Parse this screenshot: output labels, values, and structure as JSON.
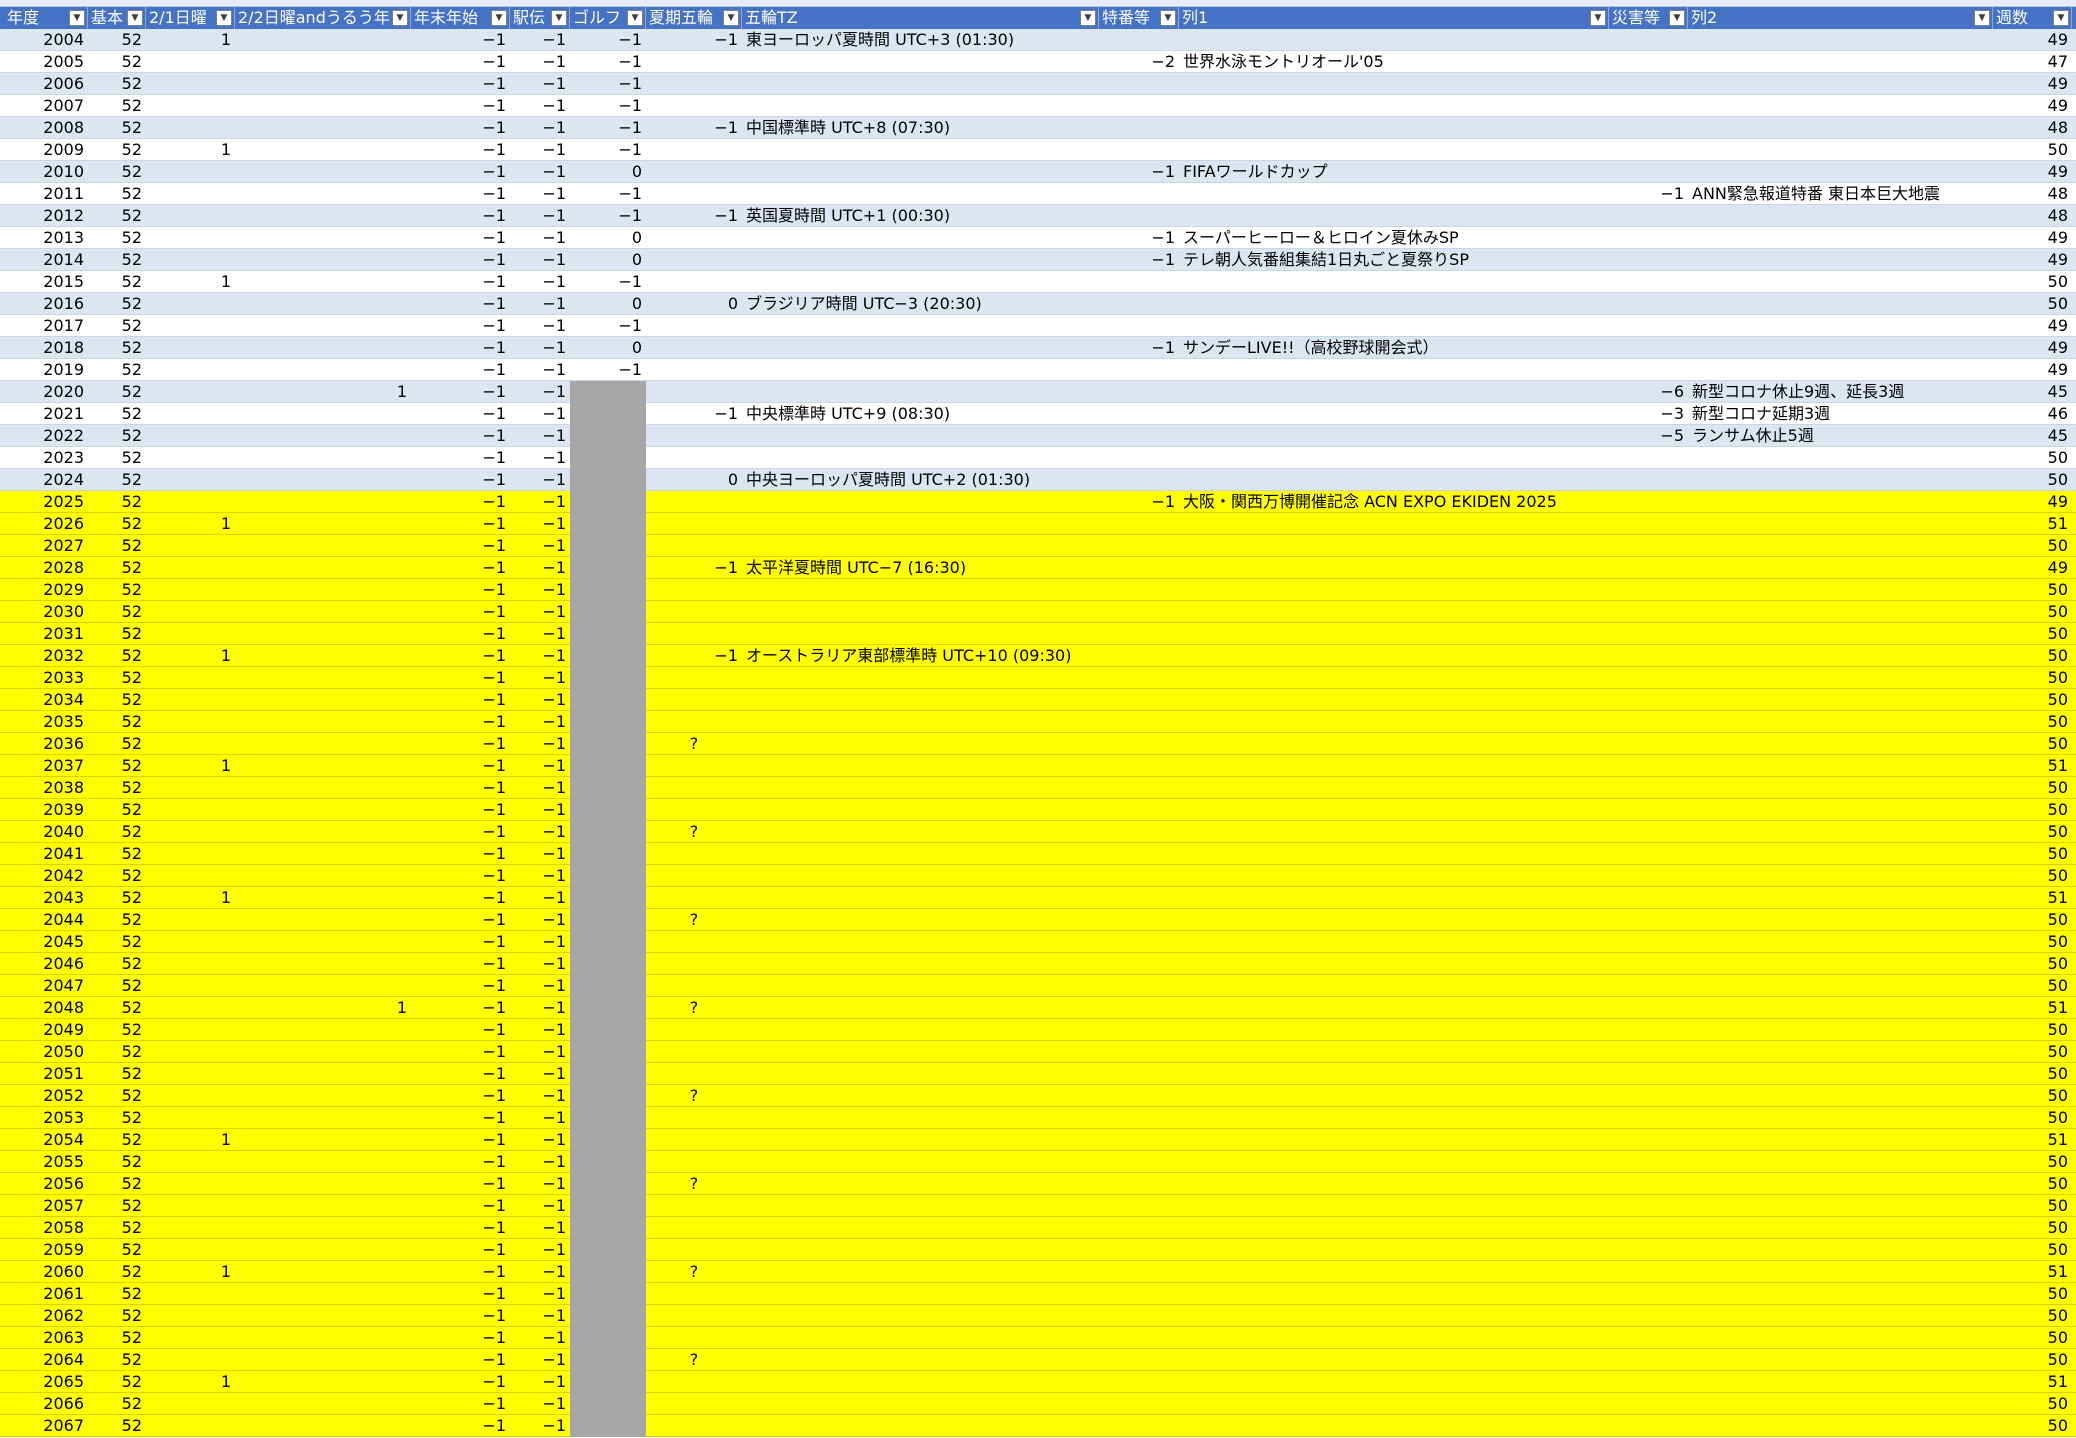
{
  "header": {
    "columns": [
      {
        "key": "year",
        "label": "年度"
      },
      {
        "key": "base",
        "label": "基本"
      },
      {
        "key": "sun21",
        "label": "2/1日曜"
      },
      {
        "key": "sun22",
        "label": "2/2日曜andうるう年"
      },
      {
        "key": "nye",
        "label": "年末年始"
      },
      {
        "key": "ekiden",
        "label": "駅伝"
      },
      {
        "key": "golf",
        "label": "ゴルフ"
      },
      {
        "key": "summer",
        "label": "夏期五輪"
      },
      {
        "key": "tz",
        "label": "五輪TZ"
      },
      {
        "key": "special",
        "label": "特番等"
      },
      {
        "key": "col1",
        "label": "列1"
      },
      {
        "key": "disaster",
        "label": "災害等"
      },
      {
        "key": "col2",
        "label": "列2"
      },
      {
        "key": "weeks",
        "label": "週数"
      }
    ],
    "filter_icon": "dropdown-arrow-icon",
    "filter_glyph": "▼"
  },
  "colors": {
    "header_bg": "#4472C4",
    "band_bg": "#DCE6F1",
    "forecast_bg": "#FFFF00",
    "golf_blank_bg": "#A6A6A6"
  },
  "rows": [
    {
      "year": "2004",
      "base": "52",
      "sun21": "1",
      "sun22": "",
      "nye": "−1",
      "ekiden": "−1",
      "golf": "−1",
      "summer": "−1",
      "tz": "東ヨーロッパ夏時間 UTC+3 (01:30)",
      "special": "",
      "col1": "",
      "disaster": "",
      "col2": "",
      "weeks": "49"
    },
    {
      "year": "2005",
      "base": "52",
      "sun21": "",
      "sun22": "",
      "nye": "−1",
      "ekiden": "−1",
      "golf": "−1",
      "summer": "",
      "tz": "",
      "special": "−2",
      "col1": "世界水泳モントリオール'05",
      "disaster": "",
      "col2": "",
      "weeks": "47"
    },
    {
      "year": "2006",
      "base": "52",
      "sun21": "",
      "sun22": "",
      "nye": "−1",
      "ekiden": "−1",
      "golf": "−1",
      "summer": "",
      "tz": "",
      "special": "",
      "col1": "",
      "disaster": "",
      "col2": "",
      "weeks": "49"
    },
    {
      "year": "2007",
      "base": "52",
      "sun21": "",
      "sun22": "",
      "nye": "−1",
      "ekiden": "−1",
      "golf": "−1",
      "summer": "",
      "tz": "",
      "special": "",
      "col1": "",
      "disaster": "",
      "col2": "",
      "weeks": "49"
    },
    {
      "year": "2008",
      "base": "52",
      "sun21": "",
      "sun22": "",
      "nye": "−1",
      "ekiden": "−1",
      "golf": "−1",
      "summer": "−1",
      "tz": "中国標準時 UTC+8 (07:30)",
      "special": "",
      "col1": "",
      "disaster": "",
      "col2": "",
      "weeks": "48"
    },
    {
      "year": "2009",
      "base": "52",
      "sun21": "1",
      "sun22": "",
      "nye": "−1",
      "ekiden": "−1",
      "golf": "−1",
      "summer": "",
      "tz": "",
      "special": "",
      "col1": "",
      "disaster": "",
      "col2": "",
      "weeks": "50"
    },
    {
      "year": "2010",
      "base": "52",
      "sun21": "",
      "sun22": "",
      "nye": "−1",
      "ekiden": "−1",
      "golf": "0",
      "summer": "",
      "tz": "",
      "special": "−1",
      "col1": "FIFAワールドカップ",
      "disaster": "",
      "col2": "",
      "weeks": "49"
    },
    {
      "year": "2011",
      "base": "52",
      "sun21": "",
      "sun22": "",
      "nye": "−1",
      "ekiden": "−1",
      "golf": "−1",
      "summer": "",
      "tz": "",
      "special": "",
      "col1": "",
      "disaster": "−1",
      "col2": "ANN緊急報道特番 東日本巨大地震",
      "weeks": "48"
    },
    {
      "year": "2012",
      "base": "52",
      "sun21": "",
      "sun22": "",
      "nye": "−1",
      "ekiden": "−1",
      "golf": "−1",
      "summer": "−1",
      "tz": "英国夏時間 UTC+1 (00:30)",
      "special": "",
      "col1": "",
      "disaster": "",
      "col2": "",
      "weeks": "48"
    },
    {
      "year": "2013",
      "base": "52",
      "sun21": "",
      "sun22": "",
      "nye": "−1",
      "ekiden": "−1",
      "golf": "0",
      "summer": "",
      "tz": "",
      "special": "−1",
      "col1": "スーパーヒーロー＆ヒロイン夏休みSP",
      "disaster": "",
      "col2": "",
      "weeks": "49"
    },
    {
      "year": "2014",
      "base": "52",
      "sun21": "",
      "sun22": "",
      "nye": "−1",
      "ekiden": "−1",
      "golf": "0",
      "summer": "",
      "tz": "",
      "special": "−1",
      "col1": "テレ朝人気番組集結1日丸ごと夏祭りSP",
      "disaster": "",
      "col2": "",
      "weeks": "49"
    },
    {
      "year": "2015",
      "base": "52",
      "sun21": "1",
      "sun22": "",
      "nye": "−1",
      "ekiden": "−1",
      "golf": "−1",
      "summer": "",
      "tz": "",
      "special": "",
      "col1": "",
      "disaster": "",
      "col2": "",
      "weeks": "50"
    },
    {
      "year": "2016",
      "base": "52",
      "sun21": "",
      "sun22": "",
      "nye": "−1",
      "ekiden": "−1",
      "golf": "0",
      "summer": "0",
      "tz": "ブラジリア時間 UTC−3 (20:30)",
      "special": "",
      "col1": "",
      "disaster": "",
      "col2": "",
      "weeks": "50"
    },
    {
      "year": "2017",
      "base": "52",
      "sun21": "",
      "sun22": "",
      "nye": "−1",
      "ekiden": "−1",
      "golf": "−1",
      "summer": "",
      "tz": "",
      "special": "",
      "col1": "",
      "disaster": "",
      "col2": "",
      "weeks": "49"
    },
    {
      "year": "2018",
      "base": "52",
      "sun21": "",
      "sun22": "",
      "nye": "−1",
      "ekiden": "−1",
      "golf": "0",
      "summer": "",
      "tz": "",
      "special": "−1",
      "col1": "サンデーLIVE!!（高校野球開会式）",
      "disaster": "",
      "col2": "",
      "weeks": "49"
    },
    {
      "year": "2019",
      "base": "52",
      "sun21": "",
      "sun22": "",
      "nye": "−1",
      "ekiden": "−1",
      "golf": "−1",
      "summer": "",
      "tz": "",
      "special": "",
      "col1": "",
      "disaster": "",
      "col2": "",
      "weeks": "49"
    },
    {
      "year": "2020",
      "base": "52",
      "sun21": "",
      "sun22": "1",
      "nye": "−1",
      "ekiden": "−1",
      "golf": "",
      "summer": "",
      "tz": "",
      "special": "",
      "col1": "",
      "disaster": "−6",
      "col2": "新型コロナ休止9週、延長3週",
      "weeks": "45"
    },
    {
      "year": "2021",
      "base": "52",
      "sun21": "",
      "sun22": "",
      "nye": "−1",
      "ekiden": "−1",
      "golf": "",
      "summer": "−1",
      "tz": "中央標準時 UTC+9 (08:30)",
      "special": "",
      "col1": "",
      "disaster": "−3",
      "col2": "新型コロナ延期3週",
      "weeks": "46"
    },
    {
      "year": "2022",
      "base": "52",
      "sun21": "",
      "sun22": "",
      "nye": "−1",
      "ekiden": "−1",
      "golf": "",
      "summer": "",
      "tz": "",
      "special": "",
      "col1": "",
      "disaster": "−5",
      "col2": "ランサム休止5週",
      "weeks": "45"
    },
    {
      "year": "2023",
      "base": "52",
      "sun21": "",
      "sun22": "",
      "nye": "−1",
      "ekiden": "−1",
      "golf": "",
      "summer": "",
      "tz": "",
      "special": "",
      "col1": "",
      "disaster": "",
      "col2": "",
      "weeks": "50"
    },
    {
      "year": "2024",
      "base": "52",
      "sun21": "",
      "sun22": "",
      "nye": "−1",
      "ekiden": "−1",
      "golf": "",
      "summer": "0",
      "tz": "中央ヨーロッパ夏時間 UTC+2 (01:30)",
      "special": "",
      "col1": "",
      "disaster": "",
      "col2": "",
      "weeks": "50"
    },
    {
      "year": "2025",
      "base": "52",
      "sun21": "",
      "sun22": "",
      "nye": "−1",
      "ekiden": "−1",
      "golf": "",
      "summer": "",
      "tz": "",
      "special": "−1",
      "col1": "大阪・関西万博開催記念 ACN EXPO EKIDEN 2025",
      "disaster": "",
      "col2": "",
      "weeks": "49"
    },
    {
      "year": "2026",
      "base": "52",
      "sun21": "1",
      "sun22": "",
      "nye": "−1",
      "ekiden": "−1",
      "golf": "",
      "summer": "",
      "tz": "",
      "special": "",
      "col1": "",
      "disaster": "",
      "col2": "",
      "weeks": "51"
    },
    {
      "year": "2027",
      "base": "52",
      "sun21": "",
      "sun22": "",
      "nye": "−1",
      "ekiden": "−1",
      "golf": "",
      "summer": "",
      "tz": "",
      "special": "",
      "col1": "",
      "disaster": "",
      "col2": "",
      "weeks": "50"
    },
    {
      "year": "2028",
      "base": "52",
      "sun21": "",
      "sun22": "",
      "nye": "−1",
      "ekiden": "−1",
      "golf": "",
      "summer": "−1",
      "tz": "太平洋夏時間 UTC−7 (16:30)",
      "special": "",
      "col1": "",
      "disaster": "",
      "col2": "",
      "weeks": "49"
    },
    {
      "year": "2029",
      "base": "52",
      "sun21": "",
      "sun22": "",
      "nye": "−1",
      "ekiden": "−1",
      "golf": "",
      "summer": "",
      "tz": "",
      "special": "",
      "col1": "",
      "disaster": "",
      "col2": "",
      "weeks": "50"
    },
    {
      "year": "2030",
      "base": "52",
      "sun21": "",
      "sun22": "",
      "nye": "−1",
      "ekiden": "−1",
      "golf": "",
      "summer": "",
      "tz": "",
      "special": "",
      "col1": "",
      "disaster": "",
      "col2": "",
      "weeks": "50"
    },
    {
      "year": "2031",
      "base": "52",
      "sun21": "",
      "sun22": "",
      "nye": "−1",
      "ekiden": "−1",
      "golf": "",
      "summer": "",
      "tz": "",
      "special": "",
      "col1": "",
      "disaster": "",
      "col2": "",
      "weeks": "50"
    },
    {
      "year": "2032",
      "base": "52",
      "sun21": "1",
      "sun22": "",
      "nye": "−1",
      "ekiden": "−1",
      "golf": "",
      "summer": "−1",
      "tz": "オーストラリア東部標準時 UTC+10 (09:30)",
      "special": "",
      "col1": "",
      "disaster": "",
      "col2": "",
      "weeks": "50"
    },
    {
      "year": "2033",
      "base": "52",
      "sun21": "",
      "sun22": "",
      "nye": "−1",
      "ekiden": "−1",
      "golf": "",
      "summer": "",
      "tz": "",
      "special": "",
      "col1": "",
      "disaster": "",
      "col2": "",
      "weeks": "50"
    },
    {
      "year": "2034",
      "base": "52",
      "sun21": "",
      "sun22": "",
      "nye": "−1",
      "ekiden": "−1",
      "golf": "",
      "summer": "",
      "tz": "",
      "special": "",
      "col1": "",
      "disaster": "",
      "col2": "",
      "weeks": "50"
    },
    {
      "year": "2035",
      "base": "52",
      "sun21": "",
      "sun22": "",
      "nye": "−1",
      "ekiden": "−1",
      "golf": "",
      "summer": "",
      "tz": "",
      "special": "",
      "col1": "",
      "disaster": "",
      "col2": "",
      "weeks": "50"
    },
    {
      "year": "2036",
      "base": "52",
      "sun21": "",
      "sun22": "",
      "nye": "−1",
      "ekiden": "−1",
      "golf": "",
      "summer": "?",
      "tz": "",
      "special": "",
      "col1": "",
      "disaster": "",
      "col2": "",
      "weeks": "50"
    },
    {
      "year": "2037",
      "base": "52",
      "sun21": "1",
      "sun22": "",
      "nye": "−1",
      "ekiden": "−1",
      "golf": "",
      "summer": "",
      "tz": "",
      "special": "",
      "col1": "",
      "disaster": "",
      "col2": "",
      "weeks": "51"
    },
    {
      "year": "2038",
      "base": "52",
      "sun21": "",
      "sun22": "",
      "nye": "−1",
      "ekiden": "−1",
      "golf": "",
      "summer": "",
      "tz": "",
      "special": "",
      "col1": "",
      "disaster": "",
      "col2": "",
      "weeks": "50"
    },
    {
      "year": "2039",
      "base": "52",
      "sun21": "",
      "sun22": "",
      "nye": "−1",
      "ekiden": "−1",
      "golf": "",
      "summer": "",
      "tz": "",
      "special": "",
      "col1": "",
      "disaster": "",
      "col2": "",
      "weeks": "50"
    },
    {
      "year": "2040",
      "base": "52",
      "sun21": "",
      "sun22": "",
      "nye": "−1",
      "ekiden": "−1",
      "golf": "",
      "summer": "?",
      "tz": "",
      "special": "",
      "col1": "",
      "disaster": "",
      "col2": "",
      "weeks": "50"
    },
    {
      "year": "2041",
      "base": "52",
      "sun21": "",
      "sun22": "",
      "nye": "−1",
      "ekiden": "−1",
      "golf": "",
      "summer": "",
      "tz": "",
      "special": "",
      "col1": "",
      "disaster": "",
      "col2": "",
      "weeks": "50"
    },
    {
      "year": "2042",
      "base": "52",
      "sun21": "",
      "sun22": "",
      "nye": "−1",
      "ekiden": "−1",
      "golf": "",
      "summer": "",
      "tz": "",
      "special": "",
      "col1": "",
      "disaster": "",
      "col2": "",
      "weeks": "50"
    },
    {
      "year": "2043",
      "base": "52",
      "sun21": "1",
      "sun22": "",
      "nye": "−1",
      "ekiden": "−1",
      "golf": "",
      "summer": "",
      "tz": "",
      "special": "",
      "col1": "",
      "disaster": "",
      "col2": "",
      "weeks": "51"
    },
    {
      "year": "2044",
      "base": "52",
      "sun21": "",
      "sun22": "",
      "nye": "−1",
      "ekiden": "−1",
      "golf": "",
      "summer": "?",
      "tz": "",
      "special": "",
      "col1": "",
      "disaster": "",
      "col2": "",
      "weeks": "50"
    },
    {
      "year": "2045",
      "base": "52",
      "sun21": "",
      "sun22": "",
      "nye": "−1",
      "ekiden": "−1",
      "golf": "",
      "summer": "",
      "tz": "",
      "special": "",
      "col1": "",
      "disaster": "",
      "col2": "",
      "weeks": "50"
    },
    {
      "year": "2046",
      "base": "52",
      "sun21": "",
      "sun22": "",
      "nye": "−1",
      "ekiden": "−1",
      "golf": "",
      "summer": "",
      "tz": "",
      "special": "",
      "col1": "",
      "disaster": "",
      "col2": "",
      "weeks": "50"
    },
    {
      "year": "2047",
      "base": "52",
      "sun21": "",
      "sun22": "",
      "nye": "−1",
      "ekiden": "−1",
      "golf": "",
      "summer": "",
      "tz": "",
      "special": "",
      "col1": "",
      "disaster": "",
      "col2": "",
      "weeks": "50"
    },
    {
      "year": "2048",
      "base": "52",
      "sun21": "",
      "sun22": "1",
      "nye": "−1",
      "ekiden": "−1",
      "golf": "",
      "summer": "?",
      "tz": "",
      "special": "",
      "col1": "",
      "disaster": "",
      "col2": "",
      "weeks": "51"
    },
    {
      "year": "2049",
      "base": "52",
      "sun21": "",
      "sun22": "",
      "nye": "−1",
      "ekiden": "−1",
      "golf": "",
      "summer": "",
      "tz": "",
      "special": "",
      "col1": "",
      "disaster": "",
      "col2": "",
      "weeks": "50"
    },
    {
      "year": "2050",
      "base": "52",
      "sun21": "",
      "sun22": "",
      "nye": "−1",
      "ekiden": "−1",
      "golf": "",
      "summer": "",
      "tz": "",
      "special": "",
      "col1": "",
      "disaster": "",
      "col2": "",
      "weeks": "50"
    },
    {
      "year": "2051",
      "base": "52",
      "sun21": "",
      "sun22": "",
      "nye": "−1",
      "ekiden": "−1",
      "golf": "",
      "summer": "",
      "tz": "",
      "special": "",
      "col1": "",
      "disaster": "",
      "col2": "",
      "weeks": "50"
    },
    {
      "year": "2052",
      "base": "52",
      "sun21": "",
      "sun22": "",
      "nye": "−1",
      "ekiden": "−1",
      "golf": "",
      "summer": "?",
      "tz": "",
      "special": "",
      "col1": "",
      "disaster": "",
      "col2": "",
      "weeks": "50"
    },
    {
      "year": "2053",
      "base": "52",
      "sun21": "",
      "sun22": "",
      "nye": "−1",
      "ekiden": "−1",
      "golf": "",
      "summer": "",
      "tz": "",
      "special": "",
      "col1": "",
      "disaster": "",
      "col2": "",
      "weeks": "50"
    },
    {
      "year": "2054",
      "base": "52",
      "sun21": "1",
      "sun22": "",
      "nye": "−1",
      "ekiden": "−1",
      "golf": "",
      "summer": "",
      "tz": "",
      "special": "",
      "col1": "",
      "disaster": "",
      "col2": "",
      "weeks": "51"
    },
    {
      "year": "2055",
      "base": "52",
      "sun21": "",
      "sun22": "",
      "nye": "−1",
      "ekiden": "−1",
      "golf": "",
      "summer": "",
      "tz": "",
      "special": "",
      "col1": "",
      "disaster": "",
      "col2": "",
      "weeks": "50"
    },
    {
      "year": "2056",
      "base": "52",
      "sun21": "",
      "sun22": "",
      "nye": "−1",
      "ekiden": "−1",
      "golf": "",
      "summer": "?",
      "tz": "",
      "special": "",
      "col1": "",
      "disaster": "",
      "col2": "",
      "weeks": "50"
    },
    {
      "year": "2057",
      "base": "52",
      "sun21": "",
      "sun22": "",
      "nye": "−1",
      "ekiden": "−1",
      "golf": "",
      "summer": "",
      "tz": "",
      "special": "",
      "col1": "",
      "disaster": "",
      "col2": "",
      "weeks": "50"
    },
    {
      "year": "2058",
      "base": "52",
      "sun21": "",
      "sun22": "",
      "nye": "−1",
      "ekiden": "−1",
      "golf": "",
      "summer": "",
      "tz": "",
      "special": "",
      "col1": "",
      "disaster": "",
      "col2": "",
      "weeks": "50"
    },
    {
      "year": "2059",
      "base": "52",
      "sun21": "",
      "sun22": "",
      "nye": "−1",
      "ekiden": "−1",
      "golf": "",
      "summer": "",
      "tz": "",
      "special": "",
      "col1": "",
      "disaster": "",
      "col2": "",
      "weeks": "50"
    },
    {
      "year": "2060",
      "base": "52",
      "sun21": "1",
      "sun22": "",
      "nye": "−1",
      "ekiden": "−1",
      "golf": "",
      "summer": "?",
      "tz": "",
      "special": "",
      "col1": "",
      "disaster": "",
      "col2": "",
      "weeks": "51"
    },
    {
      "year": "2061",
      "base": "52",
      "sun21": "",
      "sun22": "",
      "nye": "−1",
      "ekiden": "−1",
      "golf": "",
      "summer": "",
      "tz": "",
      "special": "",
      "col1": "",
      "disaster": "",
      "col2": "",
      "weeks": "50"
    },
    {
      "year": "2062",
      "base": "52",
      "sun21": "",
      "sun22": "",
      "nye": "−1",
      "ekiden": "−1",
      "golf": "",
      "summer": "",
      "tz": "",
      "special": "",
      "col1": "",
      "disaster": "",
      "col2": "",
      "weeks": "50"
    },
    {
      "year": "2063",
      "base": "52",
      "sun21": "",
      "sun22": "",
      "nye": "−1",
      "ekiden": "−1",
      "golf": "",
      "summer": "",
      "tz": "",
      "special": "",
      "col1": "",
      "disaster": "",
      "col2": "",
      "weeks": "50"
    },
    {
      "year": "2064",
      "base": "52",
      "sun21": "",
      "sun22": "",
      "nye": "−1",
      "ekiden": "−1",
      "golf": "",
      "summer": "?",
      "tz": "",
      "special": "",
      "col1": "",
      "disaster": "",
      "col2": "",
      "weeks": "50"
    },
    {
      "year": "2065",
      "base": "52",
      "sun21": "1",
      "sun22": "",
      "nye": "−1",
      "ekiden": "−1",
      "golf": "",
      "summer": "",
      "tz": "",
      "special": "",
      "col1": "",
      "disaster": "",
      "col2": "",
      "weeks": "51"
    },
    {
      "year": "2066",
      "base": "52",
      "sun21": "",
      "sun22": "",
      "nye": "−1",
      "ekiden": "−1",
      "golf": "",
      "summer": "",
      "tz": "",
      "special": "",
      "col1": "",
      "disaster": "",
      "col2": "",
      "weeks": "50"
    },
    {
      "year": "2067",
      "base": "52",
      "sun21": "",
      "sun22": "",
      "nye": "−1",
      "ekiden": "−1",
      "golf": "",
      "summer": "",
      "tz": "",
      "special": "",
      "col1": "",
      "disaster": "",
      "col2": "",
      "weeks": "50"
    }
  ]
}
